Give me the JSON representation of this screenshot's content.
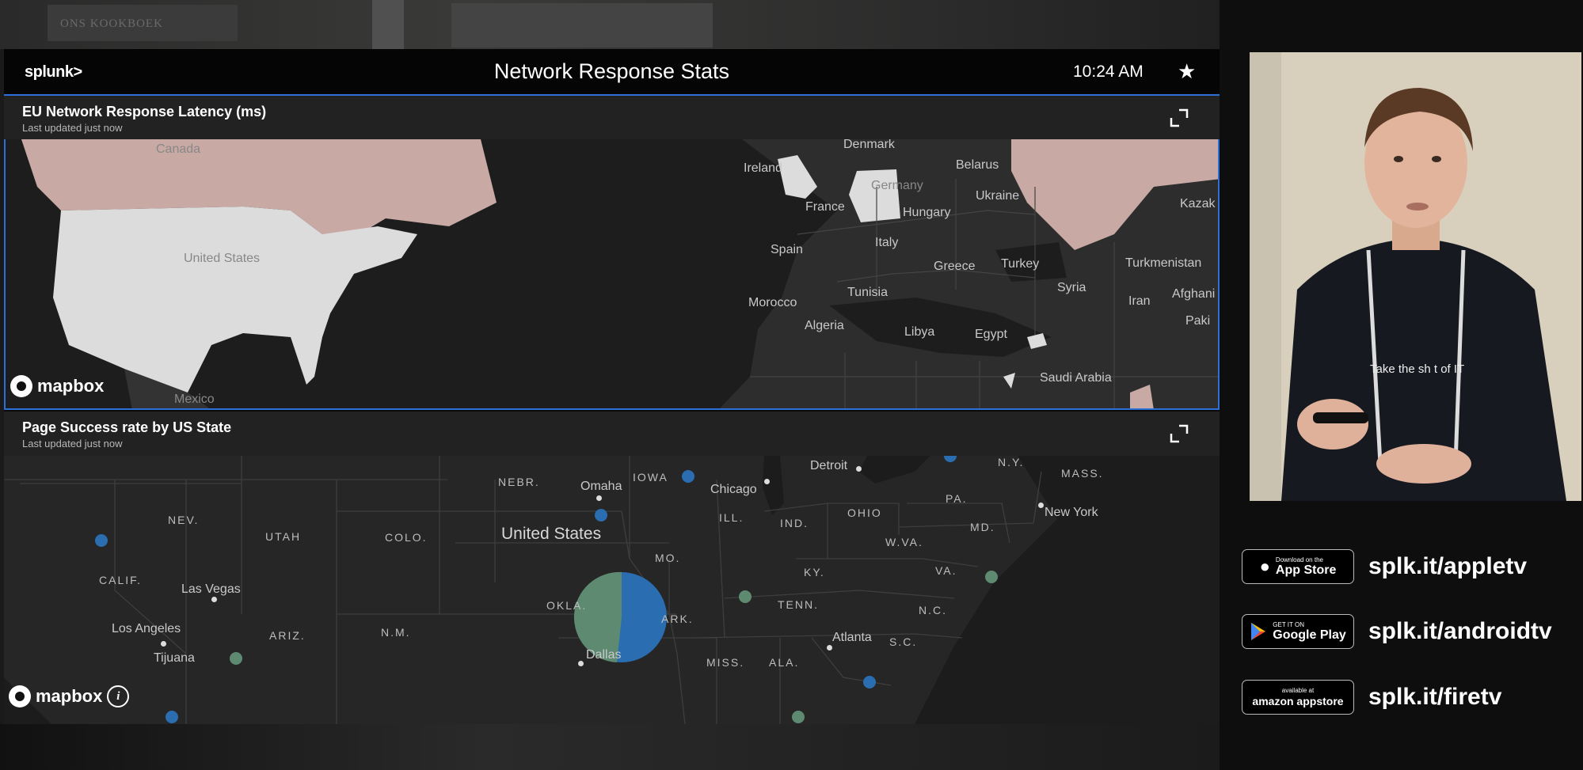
{
  "background": {
    "shelf_book_text": "ONS KOOKBOEK"
  },
  "header": {
    "brand": "splunk>",
    "title": "Network Response Stats",
    "time": "10:24 AM"
  },
  "panels": [
    {
      "title": "EU Network Response Latency (ms)",
      "updated": "Last updated just now"
    },
    {
      "title": "Page Success rate by US State",
      "updated": "Last updated just now"
    }
  ],
  "map1_labels": {
    "canada": "Canada",
    "united_states": "United States",
    "mexico": "Mexico",
    "denmark": "Denmark",
    "ireland": "Ireland",
    "belarus": "Belarus",
    "germany": "Germany",
    "ukraine": "Ukraine",
    "france": "France",
    "hungary": "Hungary",
    "kazak": "Kazak",
    "spain": "Spain",
    "italy": "Italy",
    "greece": "Greece",
    "turkey": "Turkey",
    "turkmenistan": "Turkmenistan",
    "tunisia": "Tunisia",
    "syria": "Syria",
    "afghan": "Afghani",
    "morocco": "Morocco",
    "iran": "Iran",
    "algeria": "Algeria",
    "libya": "Libya",
    "egypt": "Egypt",
    "pak": "Paki",
    "saudi": "Saudi Arabia"
  },
  "map2_labels": {
    "nebr": "NEBR.",
    "omaha": "Omaha",
    "iowa": "IOWA",
    "chicago": "Chicago",
    "detroit": "Detroit",
    "ny": "N.Y.",
    "mass": "MASS.",
    "pa": "PA.",
    "nev": "NEV.",
    "utah": "UTAH",
    "colo": "COLO.",
    "united_states": "United States",
    "ill": "ILL.",
    "ind": "IND.",
    "ohio": "OHIO",
    "new_york": "New York",
    "md": "MD.",
    "mo": "MO.",
    "wva": "W.VA.",
    "calif": "CALIF.",
    "las_vegas": "Las Vegas",
    "ky": "KY.",
    "va": "VA.",
    "okla": "OKLA.",
    "ark": "ARK.",
    "tenn": "TENN.",
    "nc": "N.C.",
    "los_angeles": "Los Angeles",
    "ariz": "ARIZ.",
    "nm": "N.M.",
    "atlanta": "Atlanta",
    "sc": "S.C.",
    "tijuana": "Tijuana",
    "dallas": "Dallas",
    "miss": "MISS.",
    "ala": "ALA."
  },
  "map_attribution": "mapbox",
  "success_pie": {
    "colors": {
      "success": "#5f8a72",
      "fail": "#2a6db0"
    }
  },
  "webcam": {
    "shirt_text": "Take the sh t of IT"
  },
  "stores": [
    {
      "small": "Download on the",
      "big": "App Store",
      "url": "splk.it/appletv",
      "icon": "apple-icon"
    },
    {
      "small": "GET IT ON",
      "big": "Google Play",
      "url": "splk.it/androidtv",
      "icon": "google-play-icon"
    },
    {
      "small": "available at",
      "big": "amazon appstore",
      "url": "splk.it/firetv",
      "icon": "amazon-icon"
    }
  ],
  "colors": {
    "accent": "#2c6fd6",
    "highlight_pink": "#c9a9a4",
    "us_fill": "#dcdcdc",
    "dot_blue": "#2a6db0",
    "dot_green": "#5f8a72"
  }
}
